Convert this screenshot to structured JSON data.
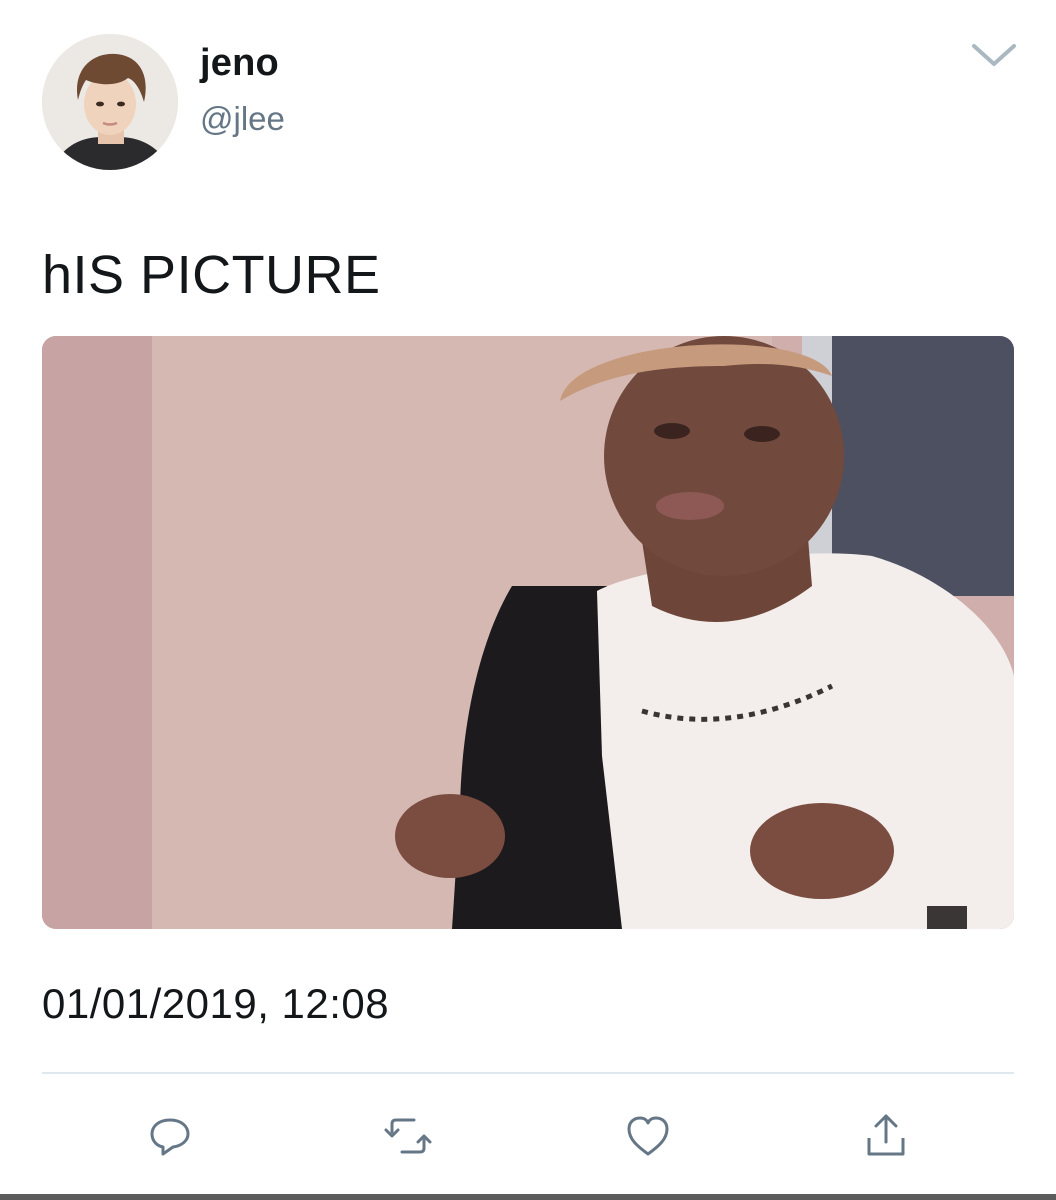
{
  "author": {
    "display_name": "jeno",
    "handle": "@jlee",
    "avatar_icon": "profile-photo"
  },
  "tweet": {
    "text": "hIS PICTURE",
    "timestamp": "01/01/2019, 12:08"
  },
  "media": {
    "type": "photo"
  },
  "icons": {
    "menu": "chevron-down-icon",
    "reply": "reply-icon",
    "retweet": "retweet-icon",
    "like": "heart-icon",
    "share": "share-icon"
  },
  "colors": {
    "text": "#14171a",
    "secondary": "#657786",
    "divider": "#e1e8ed"
  }
}
